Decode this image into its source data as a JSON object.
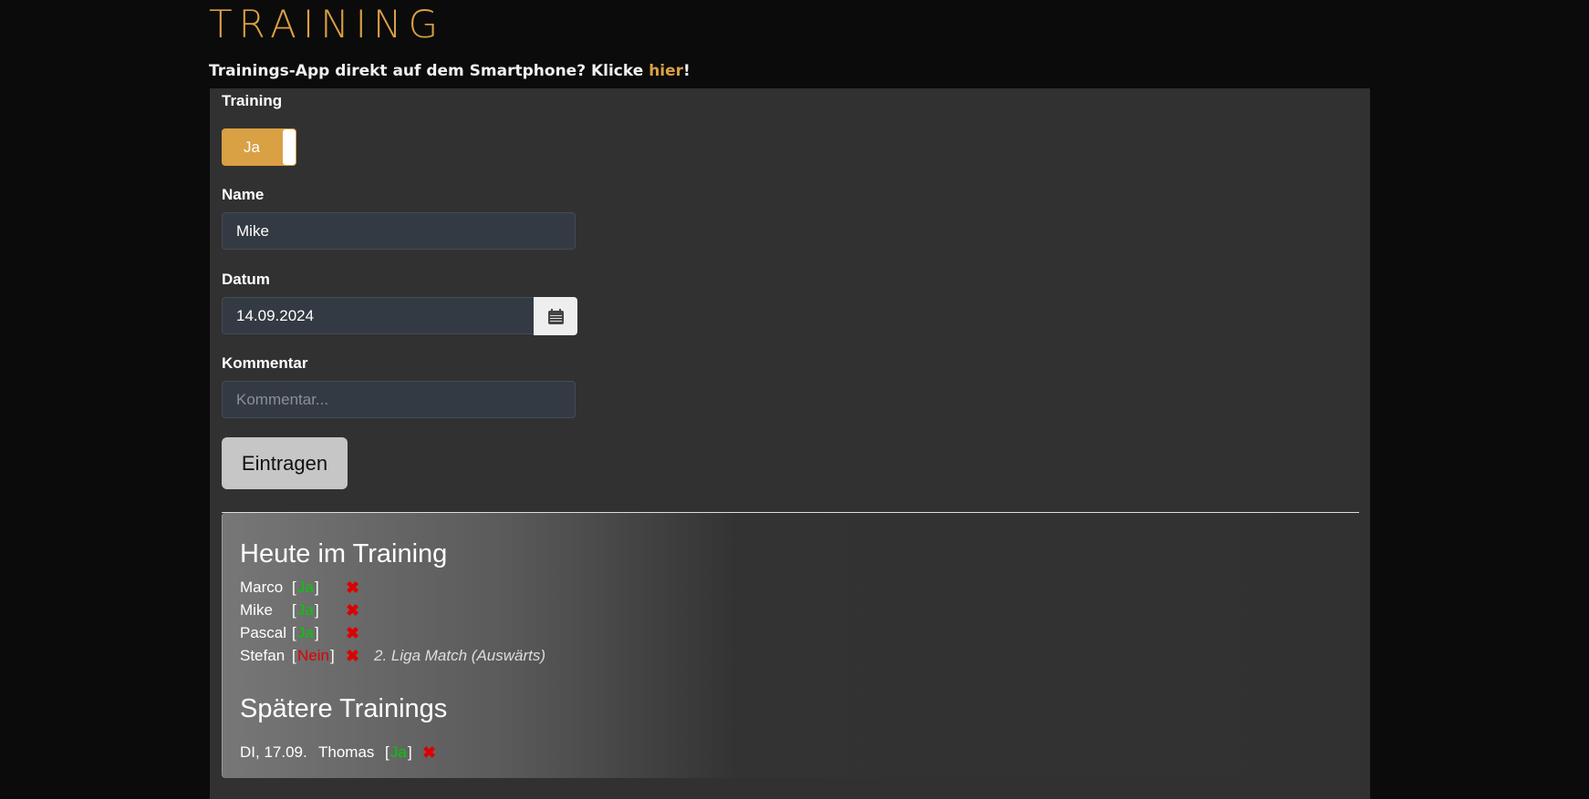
{
  "header": {
    "title": "TRAINING",
    "promo_text": "Trainings-App direkt auf dem Smartphone? Klicke ",
    "promo_link": "hier",
    "promo_end": "!"
  },
  "form": {
    "training_label": "Training",
    "training_toggle": "Ja",
    "name_label": "Name",
    "name_value": "Mike",
    "date_label": "Datum",
    "date_value": "14.09.2024",
    "comment_label": "Kommentar",
    "comment_placeholder": "Kommentar...",
    "submit": "Eintragen"
  },
  "today": {
    "heading": "Heute im Training",
    "entries": [
      {
        "name": "Marco",
        "status": "Ja",
        "comment": ""
      },
      {
        "name": "Mike",
        "status": "Ja",
        "comment": ""
      },
      {
        "name": "Pascal",
        "status": "Ja",
        "comment": ""
      },
      {
        "name": "Stefan",
        "status": "Nein",
        "comment": "2. Liga Match (Auswärts)"
      }
    ]
  },
  "later": {
    "heading": "Spätere Trainings",
    "entries": [
      {
        "date": "DI, 17.09.",
        "name": "Thomas",
        "status": "Ja"
      }
    ]
  },
  "symbols": {
    "lb": "[",
    "rb": "]",
    "delete": "✖"
  },
  "colors": {
    "accent": "#d9a044",
    "yes": "#00cc00",
    "no": "#dd0000"
  }
}
